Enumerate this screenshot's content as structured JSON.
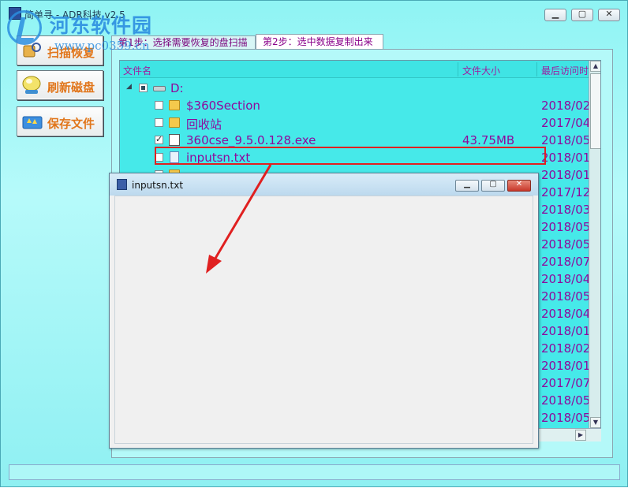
{
  "window": {
    "title": "简单寻 - ADR科技 v2.5"
  },
  "watermark": {
    "text": "河东软件园",
    "url": "www.pc0359.cn"
  },
  "sidebar": {
    "buttons": [
      {
        "label": "扫描恢复",
        "icon": "scan-icon"
      },
      {
        "label": "刷新磁盘",
        "icon": "refresh-disk-icon"
      },
      {
        "label": "保存文件",
        "icon": "save-folder-icon"
      }
    ]
  },
  "tabs": [
    {
      "label": "第1步：选择需要恢复的盘扫描",
      "active": false
    },
    {
      "label": "第2步：选中数据复制出来",
      "active": true
    }
  ],
  "table": {
    "headers": {
      "name": "文件名",
      "size": "文件大小",
      "date": "最后访问时"
    },
    "root": {
      "label": "D:"
    },
    "rows": [
      {
        "name": "$360Section",
        "type": "folder",
        "size": "",
        "date": "2018/02",
        "checked": false
      },
      {
        "name": "回收站",
        "type": "folder",
        "size": "",
        "date": "2017/04",
        "checked": false
      },
      {
        "name": "360cse_9.5.0.128.exe",
        "type": "exe",
        "size": "43.75MB",
        "date": "2018/05",
        "checked": true
      },
      {
        "name": "inputsn.txt",
        "type": "txt",
        "size": "",
        "date": "2018/01",
        "checked": false
      },
      {
        "name": "",
        "type": "folder",
        "size": "",
        "date": "2018/01",
        "checked": false
      },
      {
        "name": "",
        "type": "folder",
        "size": "",
        "date": "2017/12",
        "checked": false
      },
      {
        "name": "",
        "type": "folder",
        "size": "",
        "date": "2018/03",
        "checked": false
      },
      {
        "name": "",
        "type": "folder",
        "size": "",
        "date": "2018/05",
        "checked": false
      },
      {
        "name": "",
        "type": "folder",
        "size": "",
        "date": "2018/05",
        "checked": false
      },
      {
        "name": "",
        "type": "folder",
        "size": "",
        "date": "2018/07",
        "checked": false
      },
      {
        "name": "",
        "type": "folder",
        "size": "",
        "date": "2018/04",
        "checked": false
      },
      {
        "name": "",
        "type": "folder",
        "size": "",
        "date": "2018/05",
        "checked": false
      },
      {
        "name": "",
        "type": "folder",
        "size": "",
        "date": "2018/04",
        "checked": false
      },
      {
        "name": "",
        "type": "folder",
        "size": "",
        "date": "2018/01",
        "checked": false
      },
      {
        "name": "",
        "type": "folder",
        "size": "",
        "date": "2018/02",
        "checked": false
      },
      {
        "name": "",
        "type": "folder",
        "size": "",
        "date": "2018/01",
        "checked": false
      },
      {
        "name": "",
        "type": "folder",
        "size": "",
        "date": "2017/07",
        "checked": false
      },
      {
        "name": "",
        "type": "folder",
        "size": "",
        "date": "2018/05",
        "checked": false
      },
      {
        "name": "",
        "type": "folder",
        "size": "",
        "date": "2018/05",
        "checked": false
      }
    ]
  },
  "popup": {
    "title": "inputsn.txt"
  },
  "colors": {
    "accent_text": "#8e0a9c",
    "highlight": "#e02020",
    "background": "#8ff4f4"
  }
}
